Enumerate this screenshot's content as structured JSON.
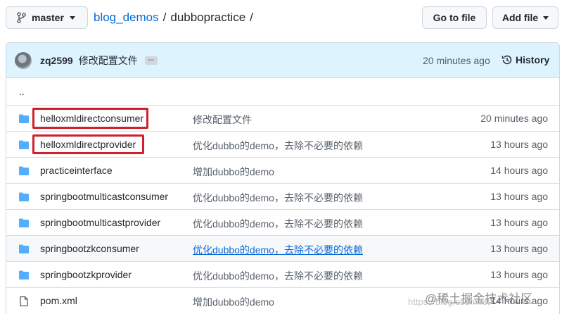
{
  "branch": {
    "name": "master"
  },
  "breadcrumb": {
    "repo": "blog_demos",
    "sep1": "/",
    "folder": "dubbopractice",
    "sep2": "/"
  },
  "actions": {
    "goto_file": "Go to file",
    "add_file": "Add file"
  },
  "commit": {
    "author": "zq2599",
    "message": "修改配置文件",
    "ellipsis": "...",
    "time": "20 minutes ago",
    "history_label": "History"
  },
  "parent_dir": "..",
  "rows": [
    {
      "type": "folder",
      "name": "helloxmldirectconsumer",
      "message": "修改配置文件",
      "age": "20 minutes ago"
    },
    {
      "type": "folder",
      "name": "helloxmldirectprovider",
      "message": "优化dubbo的demo，去除不必要的依赖",
      "age": "13 hours ago"
    },
    {
      "type": "folder",
      "name": "practiceinterface",
      "message": "增加dubbo的demo",
      "age": "14 hours ago"
    },
    {
      "type": "folder",
      "name": "springbootmulticastconsumer",
      "message": "优化dubbo的demo，去除不必要的依赖",
      "age": "13 hours ago"
    },
    {
      "type": "folder",
      "name": "springbootmulticastprovider",
      "message": "优化dubbo的demo，去除不必要的依赖",
      "age": "13 hours ago"
    },
    {
      "type": "folder",
      "name": "springbootzkconsumer",
      "message": "优化dubbo的demo，去除不必要的依赖",
      "age": "13 hours ago"
    },
    {
      "type": "folder",
      "name": "springbootzkprovider",
      "message": "优化dubbo的demo，去除不必要的依赖",
      "age": "13 hours ago"
    },
    {
      "type": "file",
      "name": "pom.xml",
      "message": "增加dubbo的demo",
      "age": "14 hours ago"
    }
  ],
  "watermark": {
    "text": "@稀土掘金技术社区",
    "sub": "https://blog.csdn.net"
  },
  "colors": {
    "accent": "#0969da",
    "folder": "#54aeff",
    "highlight": "#d0202a",
    "commit_bar": "#ddf4ff"
  }
}
